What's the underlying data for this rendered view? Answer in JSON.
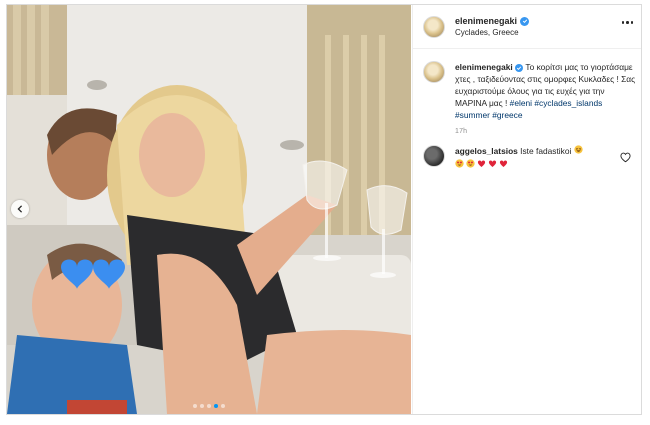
{
  "post": {
    "username": "elenimenegaki",
    "location": "Cyclades, Greece",
    "verified": true,
    "slide_count": 5,
    "active_slide": 4
  },
  "caption": {
    "username": "elenimenegaki",
    "text": "Το κορίτσι μας το γιορτάσαμε χτες , ταξιδεύοντας στις ομορφες Κυκλαδες ! Σας ευχαριστούμε όλους για τις ευχές για την ΜΑΡΙΝΑ μας ! ",
    "hashtags": [
      "#eleni",
      "#cyclades_islands",
      "#summer",
      "#greece"
    ],
    "time": "17h"
  },
  "comments": [
    {
      "username": "aggelos_latsios",
      "text": "Iste fadastikoi",
      "emojis": [
        "grinning-squint-face",
        "heart-eyes-face",
        "heart-eyes-face",
        "red-heart",
        "red-heart",
        "red-heart"
      ]
    }
  ],
  "colors": {
    "link": "#00376b",
    "verified": "#3897f0",
    "dot_active": "#0095f6",
    "border": "#dbdbdb",
    "muted": "#8e8e8e"
  }
}
